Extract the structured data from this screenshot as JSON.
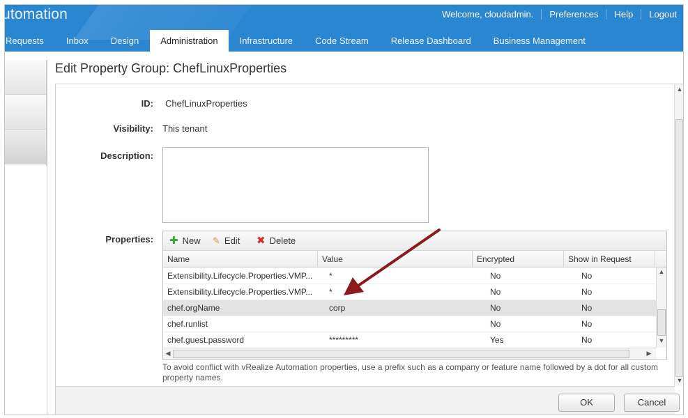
{
  "header": {
    "logo_text": "utomation",
    "welcome": "Welcome, cloudadmin.",
    "links": [
      "Preferences",
      "Help",
      "Logout"
    ]
  },
  "tabs": [
    {
      "label": "Requests"
    },
    {
      "label": "Inbox"
    },
    {
      "label": "Design"
    },
    {
      "label": "Administration",
      "active": true
    },
    {
      "label": "Infrastructure"
    },
    {
      "label": "Code Stream"
    },
    {
      "label": "Release Dashboard"
    },
    {
      "label": "Business Management"
    }
  ],
  "page": {
    "title": "Edit Property Group: ChefLinuxProperties"
  },
  "form": {
    "id_label": "ID:",
    "id_value": "ChefLinuxProperties",
    "visibility_label": "Visibility:",
    "visibility_value": "This tenant",
    "description_label": "Description:",
    "description_value": "",
    "properties_label": "Properties:"
  },
  "grid": {
    "toolbar": {
      "new": "New",
      "edit": "Edit",
      "delete": "Delete"
    },
    "columns": [
      "Name",
      "Value",
      "Encrypted",
      "Show in Request"
    ],
    "rows": [
      {
        "name": "Extensibility.Lifecycle.Properties.VMP...",
        "value": "*",
        "encrypted": "No",
        "show": "No"
      },
      {
        "name": "Extensibility.Lifecycle.Properties.VMP...",
        "value": "*",
        "encrypted": "No",
        "show": "No"
      },
      {
        "name": "chef.orgName",
        "value": "corp",
        "encrypted": "No",
        "show": "No",
        "selected": true
      },
      {
        "name": "chef.runlist",
        "value": "",
        "encrypted": "No",
        "show": "No"
      },
      {
        "name": "chef.guest.password",
        "value": "*********",
        "encrypted": "Yes",
        "show": "No"
      }
    ],
    "hint": "To avoid conflict with vRealize Automation properties, use a prefix such as a company or feature name followed by a dot for all custom property names."
  },
  "footer": {
    "ok_label": "OK",
    "cancel_label": "Cancel"
  },
  "colors": {
    "header_blue": "#2a86d1",
    "annotation_arrow": "#8b1a1a"
  }
}
